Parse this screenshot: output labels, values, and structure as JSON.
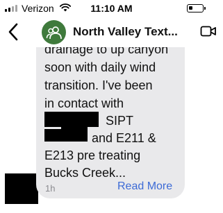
{
  "status_bar": {
    "carrier": "Verizon",
    "time": "11:10 AM"
  },
  "header": {
    "title": "North Valley Text..."
  },
  "message": {
    "lines": [
      "drainage to up canyon",
      "soon with daily wind",
      "transition.  I've been",
      "in contact with",
      "SIPT",
      "and E211 &",
      "E213 pre treating",
      "Bucks Creek..."
    ],
    "timestamp": "1h",
    "read_more": "Read More"
  },
  "colors": {
    "bubble": "#e9e9eb",
    "link": "#3d6bd6",
    "avatar": "#3f7a3c",
    "redaction": "#000000"
  },
  "icons": {
    "back": "chevron-left-icon",
    "avatar": "group-icon",
    "video": "video-camera-icon",
    "wifi": "wifi-icon",
    "battery": "battery-icon",
    "signal": "signal-icon"
  }
}
